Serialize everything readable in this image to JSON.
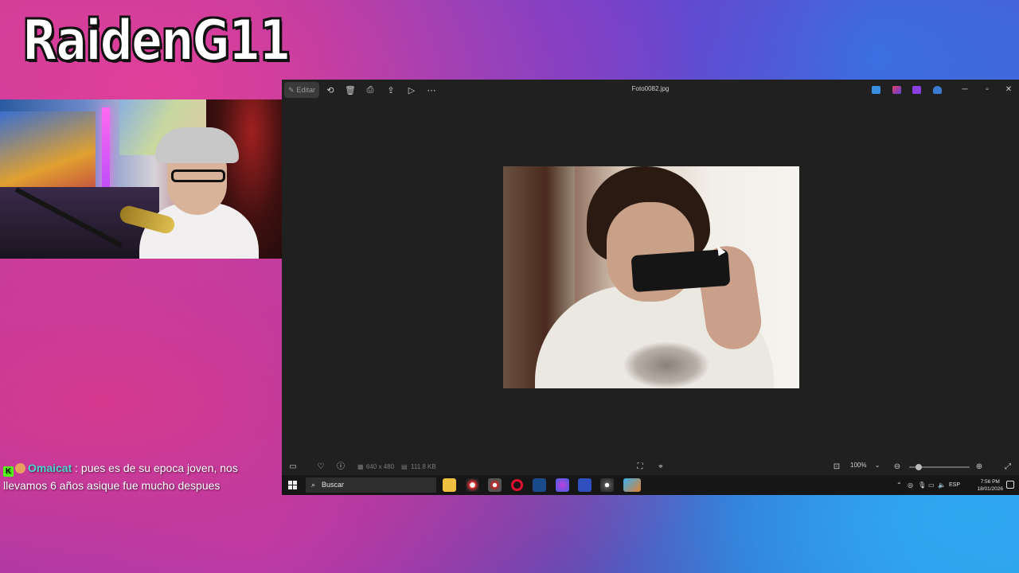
{
  "stream": {
    "streamer_name": "RaidenG11",
    "chat": {
      "username": "Omaicat",
      "message": ": pues es de su epoca joven, nos llevamos 6 años asique fue mucho despues"
    }
  },
  "photos_app": {
    "toolbar": {
      "edit_label": "Editar",
      "window_title": "Foto0082.jpg"
    },
    "bottom_bar": {
      "dimensions": "640 x 480",
      "file_size": "111.8 KB",
      "zoom": "100%"
    }
  },
  "taskbar": {
    "search_placeholder": "Buscar",
    "language": "ESP",
    "time": "7:56 PM",
    "date": "18/01/2026"
  },
  "colors": {
    "window_bg": "#202020",
    "taskbar_bg": "#161616",
    "chat_username": "#4fd6d0"
  }
}
